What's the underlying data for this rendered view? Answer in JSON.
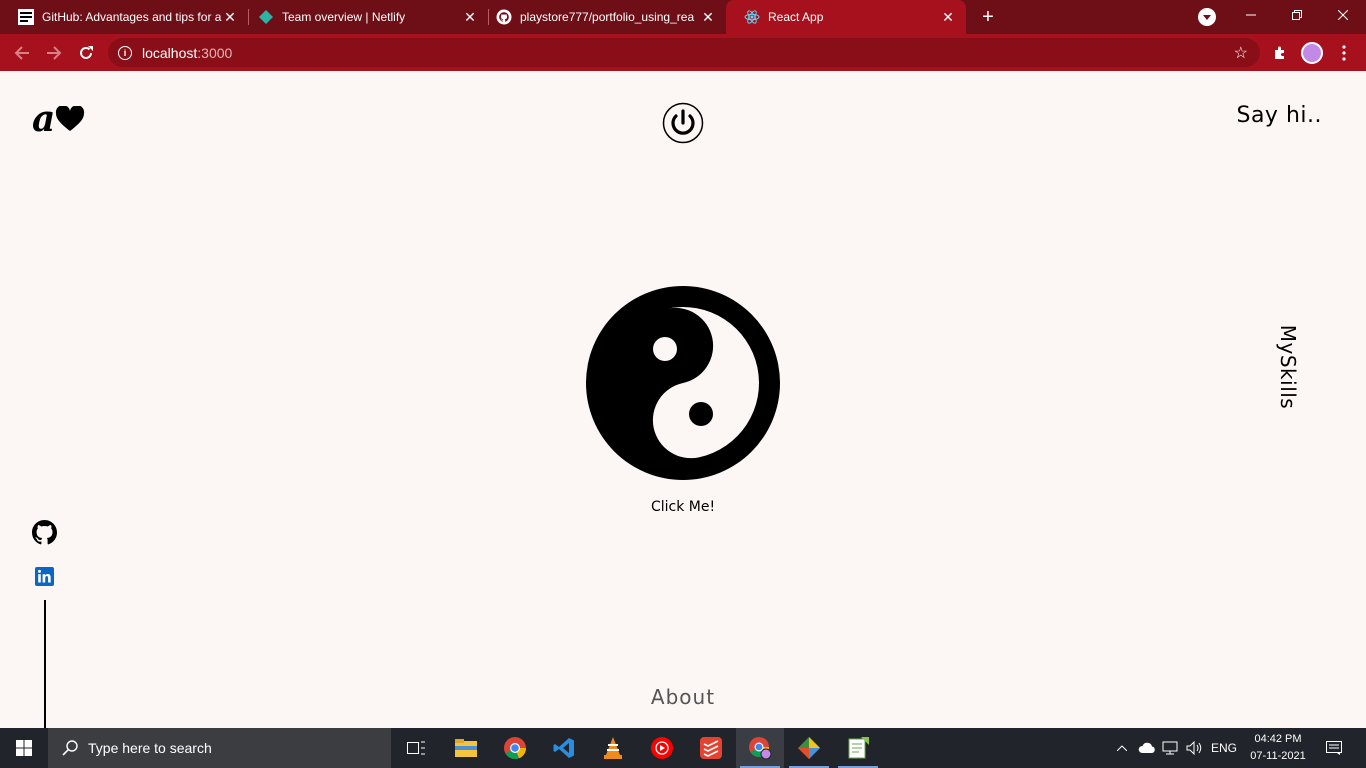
{
  "browser": {
    "tabs": [
      {
        "title": "GitHub: Advantages and tips for a",
        "icon": "newsletter-favicon"
      },
      {
        "title": "Team overview | Netlify",
        "icon": "netlify-favicon"
      },
      {
        "title": "playstore777/portfolio_using_rea",
        "icon": "github-favicon"
      },
      {
        "title": "React App",
        "icon": "react-favicon"
      }
    ],
    "address": {
      "host": "localhost",
      "port": ":3000"
    }
  },
  "page": {
    "logo_letter": "a",
    "say_hi": "Say hi..",
    "myskills": "MySkills",
    "click_me": "Click Me!",
    "about": "About"
  },
  "taskbar": {
    "search_placeholder": "Type here to search",
    "language": "ENG",
    "time": "04:42 PM",
    "date": "07-11-2021",
    "apps": [
      "task-view",
      "file-explorer",
      "chrome",
      "vscode",
      "vlc",
      "youtube-music",
      "todoist",
      "chrome-profile",
      "git",
      "notepad-plus"
    ]
  },
  "colors": {
    "tabstrip": "#6e0f17",
    "toolbar": "#a6111d",
    "page_bg": "#fcf6f4",
    "taskbar": "#21242b",
    "linkedin": "#0a66c2"
  }
}
